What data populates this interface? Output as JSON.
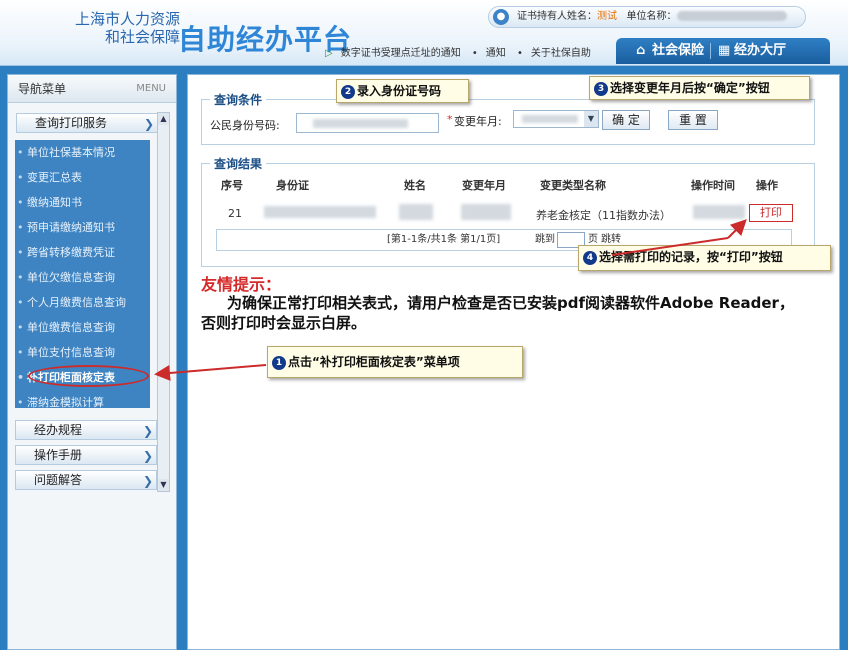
{
  "header": {
    "logo_line1": "上海市人力资源",
    "logo_line2": "和社会保障",
    "brand": "自助经办平台",
    "user_label": "证书持有人姓名：",
    "user_name": "测试",
    "unit_label": "单位名称：",
    "notices": [
      "数字证书受理点迁址的通知",
      "通知",
      "关于社保自助"
    ],
    "tabs": [
      "社会保险",
      "经办大厅"
    ]
  },
  "sidebar": {
    "title": "导航菜单",
    "title_en": "MENU",
    "groups": [
      "查询打印服务",
      "经办规程",
      "操作手册",
      "问题解答"
    ],
    "items": [
      "单位社保基本情况",
      "变更汇总表",
      "缴纳通知书",
      "预申请缴纳通知书",
      "跨省转移缴费凭证",
      "单位欠缴信息查询",
      "个人月缴费信息查询",
      "单位缴费信息查询",
      "单位支付信息查询",
      "补打印柜面核定表",
      "滞纳金模拟计算"
    ]
  },
  "query": {
    "legend": "查询条件",
    "id_label": "公民身份号码:",
    "month_label": "变更年月:",
    "required_mark": "*",
    "confirm_btn": "确 定",
    "reset_btn": "重 置"
  },
  "results": {
    "legend": "查询结果",
    "headers": [
      "序号",
      "身份证",
      "姓名",
      "变更年月",
      "变更类型名称",
      "操作时间",
      "操作"
    ],
    "row": {
      "seq": "21",
      "type": "养老金核定（11指数办法）",
      "action": "打印"
    },
    "pager_text": "[第1-1条/共1条 第1/1页]",
    "jump_label": "跳到",
    "page_unit": "页",
    "jump_btn": "跳转"
  },
  "tip": {
    "title": "友情提示：",
    "body": "为确保正常打印相关表式，请用户检查是否已安装pdf阅读器软件Adobe Reader，否则打印时会显示白屏。"
  },
  "callouts": [
    {
      "num": "1",
      "text": "点击“补打印柜面核定表”菜单项"
    },
    {
      "num": "2",
      "text": "录入身份证号码"
    },
    {
      "num": "3",
      "text": "选择变更年月后按“确定”按钮"
    },
    {
      "num": "4",
      "text": "选择需打印的记录，按“打印”按钮"
    }
  ]
}
